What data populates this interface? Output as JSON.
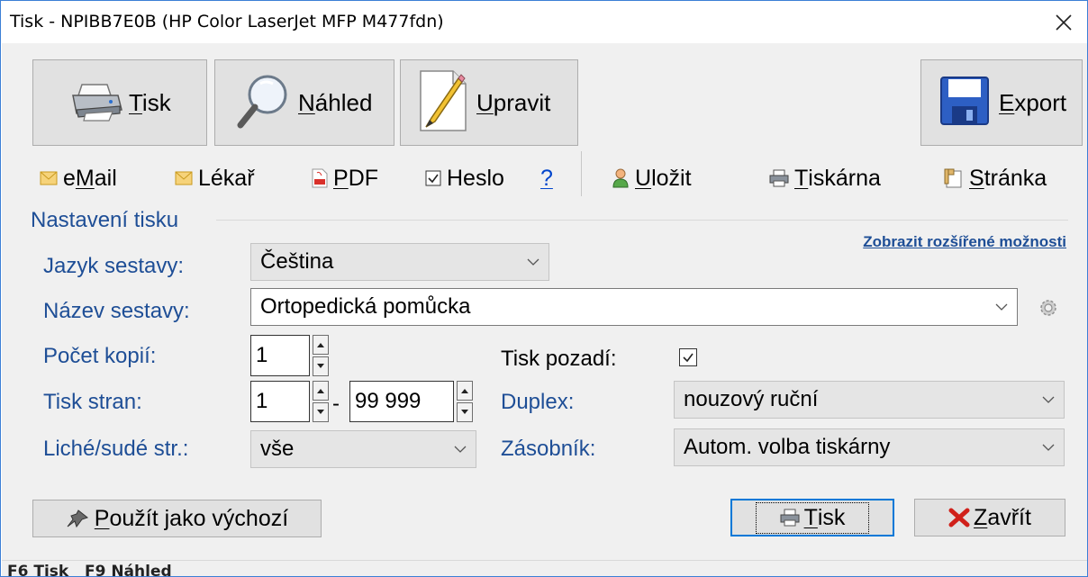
{
  "window": {
    "title": "Tisk - NPIBB7E0B (HP Color LaserJet MFP M477fdn)",
    "close_glyph": "✕"
  },
  "big_buttons": {
    "print_first": "T",
    "print_rest": "isk",
    "preview_first": "N",
    "preview_rest": "áhled",
    "edit_first": "U",
    "edit_rest": "pravit",
    "export_first": "E",
    "export_rest": "xport"
  },
  "toolbar": {
    "email_a": "e",
    "email_u": "M",
    "email_b": "ail",
    "doctor": "Lékař",
    "pdf_u": "P",
    "pdf_b": "DF",
    "password": "Heslo",
    "help": "?",
    "save_u": "U",
    "save_b": "ložit",
    "printer_u": "T",
    "printer_b": "iskárna",
    "page_u": "S",
    "page_b": "tránka",
    "password_checked": true
  },
  "settings": {
    "group_title": "Nastavení tisku",
    "advanced_link": "Zobrazit rozšířené možnosti",
    "language_label": "Jazyk sestavy:",
    "language_value": "Čeština",
    "report_label": "Název sestavy:",
    "report_value": "Ortopedická pomůcka",
    "copies_label": "Počet kopií:",
    "copies_value": "1",
    "background_label": "Tisk pozadí:",
    "background_checked": true,
    "pages_label": "Tisk stran:",
    "pages_from": "1",
    "pages_dash": "-",
    "pages_to": "99 999",
    "duplex_label": "Duplex:",
    "duplex_value": "nouzový ruční",
    "oddeven_label": "Liché/sudé str.:",
    "oddeven_value": "vše",
    "tray_label": "Zásobník:",
    "tray_value": "Autom. volba tiskárny"
  },
  "footer": {
    "default_first": "P",
    "default_rest": "oužít jako výchozí",
    "print_first": "T",
    "print_rest": "isk",
    "close_first": "Z",
    "close_rest": "avřít"
  },
  "statusbar": {
    "text": "F6 Tisk   F9 Náhled"
  },
  "colors": {
    "label_blue": "#1e4e96",
    "window_border": "#3c7fd6",
    "default_button_border": "#0078d7"
  }
}
